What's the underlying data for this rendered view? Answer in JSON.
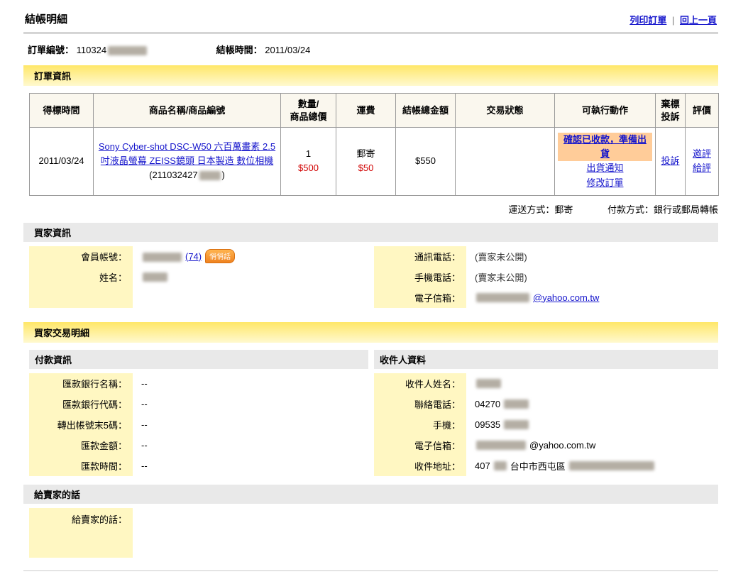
{
  "page": {
    "title": "結帳明細",
    "print_link": "列印訂單",
    "link_sep": "|",
    "back_link": "回上一頁"
  },
  "order_meta": {
    "order_no_label": "訂單編號：",
    "order_no_visible": "110324",
    "checkout_time_label": "結帳時間：",
    "checkout_time": "2011/03/24"
  },
  "order_info": {
    "section_title": "訂單資訊",
    "headers": [
      "得標時間",
      "商品名稱/商品編號",
      "數量/\n商品總價",
      "運費",
      "結帳總金額",
      "交易狀態",
      "可執行動作",
      "棄標\n投訴",
      "評價"
    ],
    "row": {
      "win_time": "2011/03/24",
      "product_title": "Sony Cyber-shot DSC-W50 六百萬畫素 2.5吋液晶螢幕 ZEISS鏡頭 日本製造 數位相機",
      "product_id_prefix": "(211032427",
      "product_id_suffix": ")",
      "qty": "1",
      "item_total": "$500",
      "ship_method": "郵寄",
      "ship_fee": "$50",
      "checkout_total": "$550",
      "status": "",
      "action_primary": "確認已收款，準備出貨",
      "action_ship_notice": "出貨通知",
      "action_modify": "修改訂單",
      "complaint_link": "投訴",
      "invite_rating_link": "邀評",
      "give_rating_link": "給評"
    },
    "note_shipping": "運送方式：郵寄",
    "note_payment": "付款方式：銀行或郵局轉帳"
  },
  "buyer_info": {
    "section_title": "買家資訊",
    "account_label": "會員帳號：",
    "rating_link": "(74)",
    "whisper_badge": "悄悄話",
    "name_label": "姓名：",
    "contact_phone_label": "通訊電話：",
    "contact_phone_value": "(賣家未公開)",
    "mobile_label": "手機電話：",
    "mobile_value": "(賣家未公開)",
    "email_label": "電子信箱：",
    "email_domain": "@yahoo.com.tw"
  },
  "transaction": {
    "section_title": "買家交易明細",
    "payment_title": "付款資訊",
    "recipient_title": "收件人資料",
    "payment_fields": [
      {
        "label": "匯款銀行名稱：",
        "value": "--"
      },
      {
        "label": "匯款銀行代碼：",
        "value": "--"
      },
      {
        "label": "轉出帳號末5碼：",
        "value": "--"
      },
      {
        "label": "匯款金額：",
        "value": "--"
      },
      {
        "label": "匯款時間：",
        "value": "--"
      }
    ],
    "recipient": {
      "name_label": "收件人姓名：",
      "phone_label": "聯絡電話：",
      "phone_visible": "04270",
      "mobile_label": "手機：",
      "mobile_visible": "09535",
      "email_label": "電子信箱：",
      "email_domain": "@yahoo.com.tw",
      "address_label": "收件地址：",
      "address_zip": "407",
      "address_district": "台中市西屯區"
    }
  },
  "message": {
    "section_title": "給賣家的話",
    "label": "給賣家的話："
  }
}
